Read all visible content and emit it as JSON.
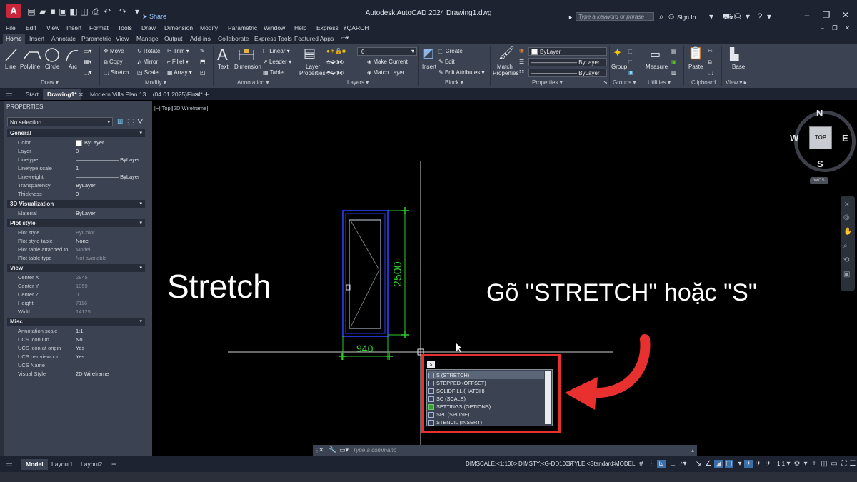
{
  "window": {
    "app_logo": "A",
    "title": "Autodesk AutoCAD 2024   Drawing1.dwg",
    "search_placeholder": "Type a keyword or phrase",
    "sign_in": "Sign In",
    "share": "Share"
  },
  "menu": [
    "File",
    "Edit",
    "View",
    "Insert",
    "Format",
    "Tools",
    "Draw",
    "Dimension",
    "Modify",
    "Parametric",
    "Window",
    "Help",
    "Express",
    "YQARCH"
  ],
  "ribbon_tabs": [
    "Home",
    "Insert",
    "Annotate",
    "Parametric",
    "View",
    "Manage",
    "Output",
    "Add-ins",
    "Collaborate",
    "Express Tools",
    "Featured Apps"
  ],
  "ribbon": {
    "draw": {
      "title": "Draw",
      "line": "Line",
      "polyline": "Polyline",
      "circle": "Circle",
      "arc": "Arc"
    },
    "modify": {
      "title": "Modify",
      "move": "Move",
      "rotate": "Rotate",
      "trim": "Trim",
      "copy": "Copy",
      "mirror": "Mirror",
      "fillet": "Fillet",
      "stretch": "Stretch",
      "scale": "Scale",
      "array": "Array"
    },
    "annotation": {
      "title": "Annotation",
      "text": "Text",
      "dimension": "Dimension",
      "linear": "Linear",
      "leader": "Leader",
      "table": "Table"
    },
    "layers": {
      "title": "Layers",
      "layer_properties_1": "Layer",
      "layer_properties_2": "Properties",
      "current_layer": "0",
      "make_current": "Make Current",
      "match_layer": "Match Layer"
    },
    "block": {
      "title": "Block",
      "insert": "Insert",
      "create": "Create",
      "edit": "Edit",
      "edit_attributes": "Edit Attributes"
    },
    "properties": {
      "title": "Properties",
      "match_1": "Match",
      "match_2": "Properties",
      "color": "ByLayer",
      "linetype": "ByLayer",
      "lineweight": "ByLayer"
    },
    "groups": {
      "title": "Groups",
      "group": "Group"
    },
    "utilities": {
      "title": "Utilities",
      "measure": "Measure"
    },
    "clipboard": {
      "title": "Clipboard",
      "paste": "Paste"
    },
    "view": {
      "title": "View",
      "base": "Base"
    }
  },
  "file_tabs": [
    "Start",
    "Drawing1*",
    "Modern Villa Plan 13...  (04.01.2025)Final*"
  ],
  "properties_palette": {
    "title": "PROPERTIES",
    "selection": "No selection",
    "sections": [
      {
        "name": "General",
        "rows": [
          [
            "Color",
            "ByLayer"
          ],
          [
            "Layer",
            "0"
          ],
          [
            "Linetype",
            "———————— ByLayer"
          ],
          [
            "Linetype scale",
            "1"
          ],
          [
            "Lineweight",
            "———————— ByLayer"
          ],
          [
            "Transparency",
            "ByLayer"
          ],
          [
            "Thickness",
            "0"
          ]
        ]
      },
      {
        "name": "3D Visualization",
        "rows": [
          [
            "Material",
            "ByLayer"
          ]
        ]
      },
      {
        "name": "Plot style",
        "rows": [
          [
            "Plot style",
            "ByColor"
          ],
          [
            "Plot style table",
            "None"
          ],
          [
            "Plot table attached to",
            "Model"
          ],
          [
            "Plot table type",
            "Not available"
          ]
        ]
      },
      {
        "name": "View",
        "rows": [
          [
            "Center X",
            "2845"
          ],
          [
            "Center Y",
            "1059"
          ],
          [
            "Center Z",
            "0"
          ],
          [
            "Height",
            "7116"
          ],
          [
            "Width",
            "14125"
          ]
        ]
      },
      {
        "name": "Misc",
        "rows": [
          [
            "Annotation scale",
            "1:1"
          ],
          [
            "UCS icon On",
            "No"
          ],
          [
            "UCS icon at origin",
            "Yes"
          ],
          [
            "UCS per viewport",
            "Yes"
          ],
          [
            "UCS Name",
            ""
          ],
          [
            "Visual Style",
            "2D Wireframe"
          ]
        ]
      }
    ]
  },
  "viewport": {
    "label": "[−][Top][2D Wireframe]",
    "compass": {
      "n": "N",
      "s": "S",
      "e": "E",
      "w": "W",
      "cube": "TOP",
      "wcs": "WCS"
    },
    "overlay_left": "Stretch",
    "overlay_right": "Gõ \"STRETCH\" hoặc \"S\"",
    "dim_vertical": "2500",
    "dim_horizontal": "940"
  },
  "autocomplete": {
    "typed": "s",
    "items": [
      "S (STRETCH)",
      "STEPPED (OFFSET)",
      "SOLIDFILL (HATCH)",
      "SC (SCALE)",
      "SETTINGS (OPTIONS)",
      "SPL (SPLINE)",
      "STENCIL (INSERT)"
    ]
  },
  "command_line": {
    "placeholder": "Type a command"
  },
  "layout_tabs": [
    "Model",
    "Layout1",
    "Layout2"
  ],
  "status": {
    "dimscale": "DIMSCALE:<1:100>",
    "dimsty": "DIMSTY:<G-DD100>",
    "style": "STYLE:<Standard>",
    "model": "MODEL",
    "scale": "1:1"
  },
  "colors": {
    "accent_red": "#e8312f",
    "dim_green": "#2ecc2e",
    "door_blue": "#2233cc"
  }
}
